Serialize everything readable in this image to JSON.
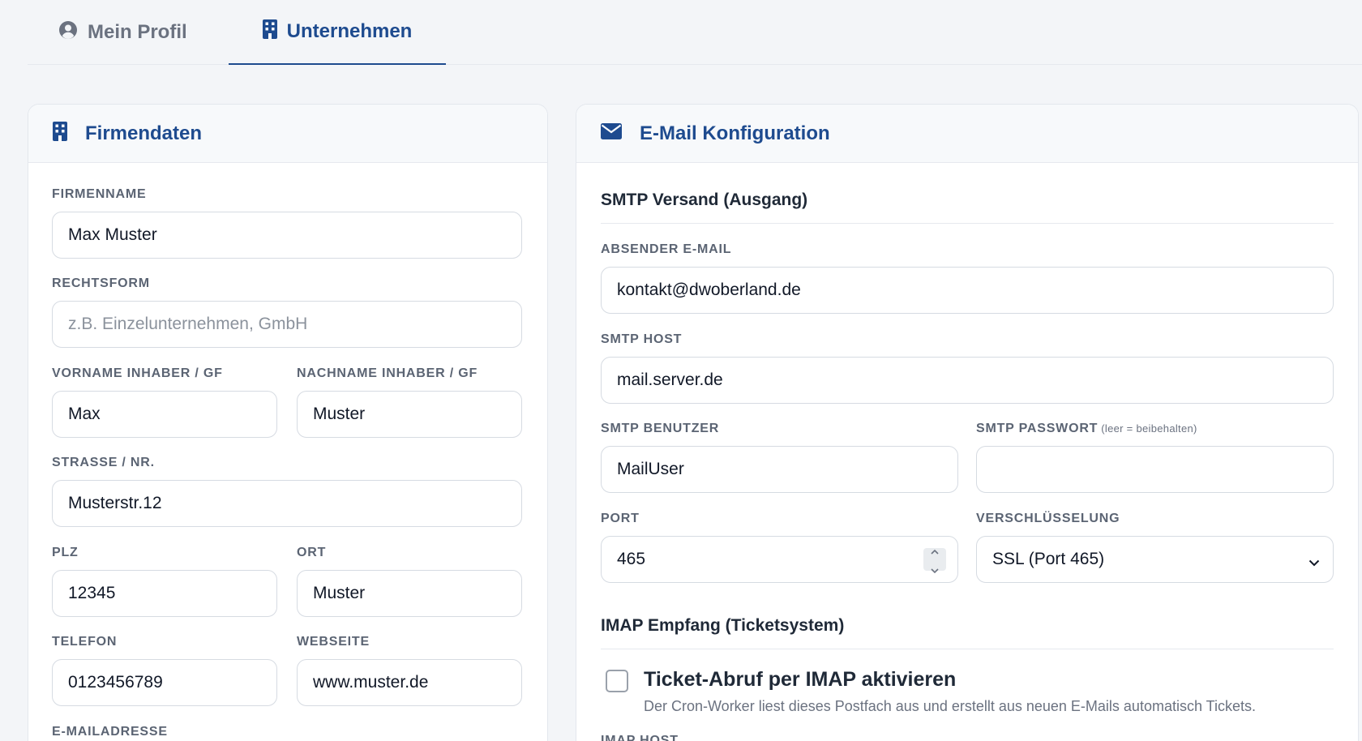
{
  "tabs": [
    {
      "label": "Mein Profil",
      "active": false,
      "icon": "user-circle-icon"
    },
    {
      "label": "Unternehmen",
      "active": true,
      "icon": "building-icon"
    }
  ],
  "company": {
    "title": "Firmendaten",
    "icon": "building-icon",
    "fields": {
      "firmenname": {
        "label": "FIRMENNAME",
        "value": "Max Muster"
      },
      "rechtsform": {
        "label": "RECHTSFORM",
        "value": "",
        "placeholder": "z.B. Einzelunternehmen, GmbH"
      },
      "vorname": {
        "label": "VORNAME INHABER / GF",
        "value": "Max"
      },
      "nachname": {
        "label": "NACHNAME INHABER / GF",
        "value": "Muster"
      },
      "strasse": {
        "label": "STRASSE / NR.",
        "value": "Musterstr.12"
      },
      "plz": {
        "label": "PLZ",
        "value": "12345"
      },
      "ort": {
        "label": "ORT",
        "value": "Muster"
      },
      "telefon": {
        "label": "TELEFON",
        "value": "0123456789"
      },
      "webseite": {
        "label": "WEBSEITE",
        "value": "www.muster.de"
      },
      "email": {
        "label": "E-MAILADRESSE"
      }
    }
  },
  "email_config": {
    "title": "E-Mail Konfiguration",
    "icon": "envelope-icon",
    "smtp": {
      "section_title": "SMTP Versand (Ausgang)",
      "sender": {
        "label": "ABSENDER E-MAIL",
        "value": "kontakt@dwoberland.de"
      },
      "host": {
        "label": "SMTP HOST",
        "value": "mail.server.de"
      },
      "user": {
        "label": "SMTP BENUTZER",
        "value": "MailUser"
      },
      "password": {
        "label": "SMTP PASSWORT",
        "hint": "(leer = beibehalten)",
        "value": ""
      },
      "port": {
        "label": "PORT",
        "value": "465"
      },
      "encryption": {
        "label": "VERSCHLÜSSELUNG",
        "value": "SSL (Port 465)"
      }
    },
    "imap": {
      "section_title": "IMAP Empfang (Ticketsystem)",
      "enable_label": "Ticket-Abruf per IMAP aktivieren",
      "enable_checked": false,
      "enable_description": "Der Cron-Worker liest dieses Postfach aus und erstellt aus neuen E-Mails automatisch Tickets.",
      "host_label": "IMAP HOST"
    }
  },
  "colors": {
    "accent": "#1e4b8f",
    "muted": "#6b7280",
    "background": "#f3f5f8"
  }
}
